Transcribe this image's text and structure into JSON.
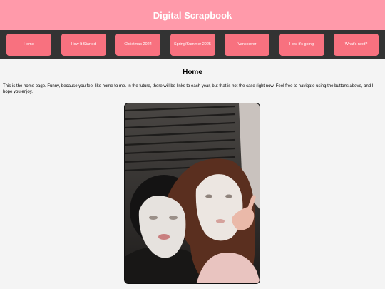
{
  "header": {
    "title": "Digital Scrapbook"
  },
  "nav": {
    "items": [
      {
        "label": "Home"
      },
      {
        "label": "How It Started"
      },
      {
        "label": "Christmas 2024"
      },
      {
        "label": "Spring/Summer 2025"
      },
      {
        "label": "Vancouver"
      },
      {
        "label": "How it's going"
      },
      {
        "label": "What's next?"
      }
    ]
  },
  "main": {
    "heading": "Home",
    "intro": "This is the home page. Funny, because you feel like home to me. In the future, there will be links to each year, but that is not the case right now. Feel free to navigate using the buttons above, and I hope you enjoy."
  },
  "colors": {
    "header_bg": "#ff9aaa",
    "nav_bg": "#333333",
    "button_bg": "#f8717f",
    "page_bg": "#f4f4f4"
  }
}
